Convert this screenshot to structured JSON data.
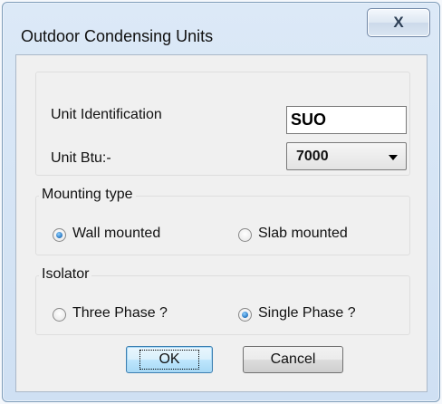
{
  "window": {
    "title": "Outdoor Condensing Units",
    "close_glyph": "X"
  },
  "unit_group": {
    "unit_identification_label": "Unit Identification",
    "unit_identification_value": "SUO",
    "unit_btu_label": "Unit Btu:-",
    "unit_btu_selected": "7000"
  },
  "mounting": {
    "legend": "Mounting type",
    "options": [
      {
        "label": "Wall mounted",
        "checked": true
      },
      {
        "label": "Slab mounted",
        "checked": false
      }
    ]
  },
  "isolator": {
    "legend": "Isolator",
    "options": [
      {
        "label": "Three Phase ?",
        "checked": false
      },
      {
        "label": "Single Phase ?",
        "checked": true
      }
    ]
  },
  "buttons": {
    "ok": "OK",
    "cancel": "Cancel"
  },
  "colors": {
    "title_bar": "#d6e5f5",
    "dialog_face": "#f0f0f0",
    "radio_selected": "#1767b6",
    "default_button_border": "#3c7fb1"
  },
  "icons": {
    "close": "close-icon",
    "dropdown": "chevron-down-icon"
  }
}
